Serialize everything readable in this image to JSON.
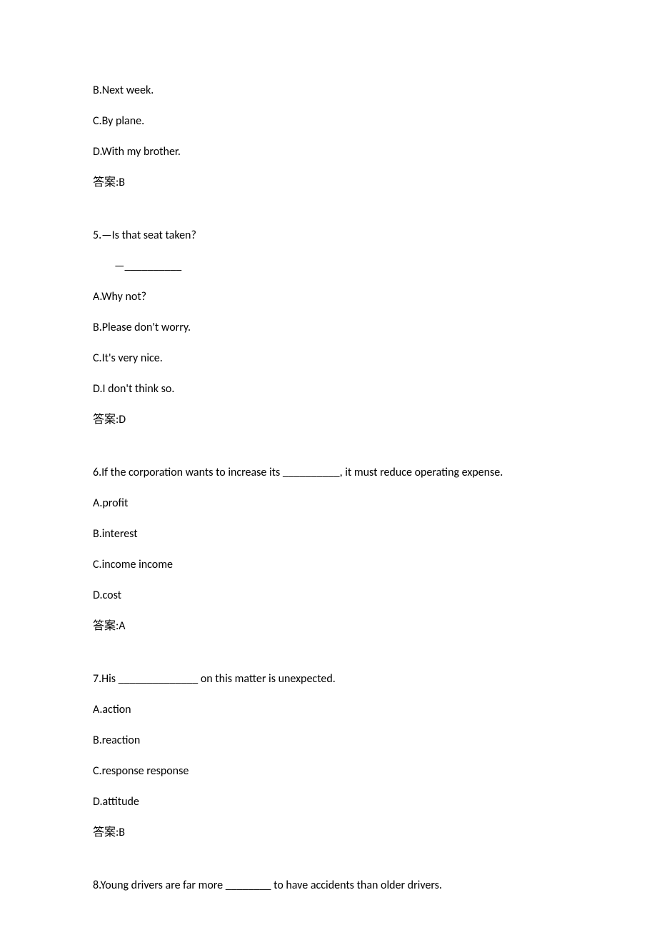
{
  "q4": {
    "optionB": "B.Next week.",
    "optionC": "C.By plane.",
    "optionD": "D.With my brother.",
    "answer": "答案:B"
  },
  "q5": {
    "prompt": "5.—Is that seat taken?",
    "sub": "—__________",
    "optionA": "A.Why not?",
    "optionB": "B.Please don't worry.",
    "optionC": "C.It's very nice.",
    "optionD": "D.I don't think so.",
    "answer": "答案:D"
  },
  "q6": {
    "prompt": "6.If the corporation wants to increase its __________, it must reduce operating expense.",
    "optionA": "A.profit",
    "optionB": "B.interest",
    "optionC": "C.income income",
    "optionD": "D.cost",
    "answer": "答案:A"
  },
  "q7": {
    "prompt": "7.His ______________ on this matter is unexpected.",
    "optionA": "A.action",
    "optionB": "B.reaction",
    "optionC": "C.response response",
    "optionD": "D.attitude",
    "answer": "答案:B"
  },
  "q8": {
    "prompt": "8.Young drivers are far more ________ to have accidents than older drivers."
  }
}
